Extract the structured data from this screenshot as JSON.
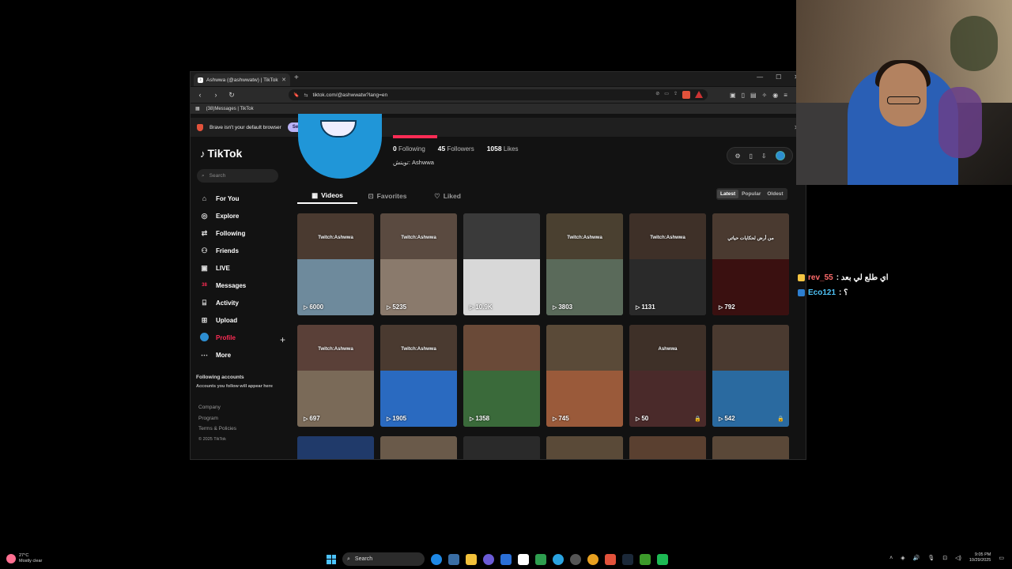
{
  "browser": {
    "tab_title": "Ashwwa (@ashwwatw) | TikTok",
    "url": "tiktok.com/@ashwwatw?lang=en",
    "bookmark": "(38)Messages | TikTok",
    "infobar_text": "Brave isn't your default browser",
    "set_default_label": "Set as default"
  },
  "sidebar": {
    "logo": "TikTok",
    "search_placeholder": "Search",
    "items": [
      {
        "label": "For You",
        "icon": "home-icon"
      },
      {
        "label": "Explore",
        "icon": "compass-icon"
      },
      {
        "label": "Following",
        "icon": "following-icon"
      },
      {
        "label": "Friends",
        "icon": "friends-icon"
      },
      {
        "label": "LIVE",
        "icon": "live-icon"
      },
      {
        "label": "Messages",
        "icon": "messages-icon"
      },
      {
        "label": "Activity",
        "icon": "activity-icon"
      },
      {
        "label": "Upload",
        "icon": "upload-icon"
      },
      {
        "label": "Profile",
        "icon": "avatar"
      },
      {
        "label": "More",
        "icon": "more-icon"
      }
    ],
    "messages_badge": "38",
    "following_accounts_title": "Following accounts",
    "following_accounts_sub": "Accounts you follow will appear here",
    "footer": [
      "Company",
      "Program",
      "Terms & Policies"
    ],
    "copyright": "© 2025 TikTok"
  },
  "profile": {
    "following_count": "0",
    "following_label": "Following",
    "followers_count": "45",
    "followers_label": "Followers",
    "likes_count": "1058",
    "likes_label": "Likes",
    "bio": "تويتش: Ashwwa",
    "tabs": [
      "Videos",
      "Favorites",
      "Liked"
    ],
    "sort": [
      "Latest",
      "Popular",
      "Oldest"
    ]
  },
  "videos": [
    {
      "views": "6000",
      "watermark": "Twitch:Ashwwa",
      "top": "#4a3a30",
      "bottom": "#6e8a9c",
      "lock": false
    },
    {
      "views": "5235",
      "watermark": "Twitch:Ashwwa",
      "top": "#5a4a40",
      "bottom": "#8a7a6c",
      "lock": false
    },
    {
      "views": "10.9K",
      "watermark": "",
      "top": "#3a3a3a",
      "bottom": "#d8d8d8",
      "lock": false
    },
    {
      "views": "3803",
      "watermark": "Twitch:Ashwwa",
      "top": "#4a4030",
      "bottom": "#5a6a5a",
      "lock": false
    },
    {
      "views": "1131",
      "watermark": "Twitch:Ashwwa",
      "top": "#3e3028",
      "bottom": "#2a2a2a",
      "lock": false
    },
    {
      "views": "792",
      "watermark": "من أرض لحكايات حياتي",
      "top": "#4a3a30",
      "bottom": "#3a1010",
      "lock": false
    },
    {
      "views": "697",
      "watermark": "Twitch:Ashwwa",
      "top": "#5a4038",
      "bottom": "#7a6a58",
      "lock": false
    },
    {
      "views": "1905",
      "watermark": "Twitch:Ashwwa",
      "top": "#4a3a30",
      "bottom": "#2a6ac0",
      "lock": false
    },
    {
      "views": "1358",
      "watermark": "",
      "top": "#6a4a38",
      "bottom": "#3a6a3a",
      "lock": false
    },
    {
      "views": "745",
      "watermark": "",
      "top": "#5a4a38",
      "bottom": "#9a5a3a",
      "lock": false
    },
    {
      "views": "50",
      "watermark": "Ashwwa",
      "top": "#3e3028",
      "bottom": "#4a2a2a",
      "lock": true
    },
    {
      "views": "542",
      "watermark": "",
      "top": "#4a3a30",
      "bottom": "#2a6aa0",
      "lock": true
    },
    {
      "views": "",
      "watermark": "",
      "top": "#203a6a",
      "bottom": "#203a6a",
      "lock": false
    },
    {
      "views": "",
      "watermark": "",
      "top": "#6a5a4a",
      "bottom": "#6a5a4a",
      "lock": false
    },
    {
      "views": "",
      "watermark": "",
      "top": "#2a2a2a",
      "bottom": "#2a2a2a",
      "lock": false
    },
    {
      "views": "",
      "watermark": "",
      "top": "#5a4a38",
      "bottom": "#5a4a38",
      "lock": false
    },
    {
      "views": "",
      "watermark": "",
      "top": "#5a4030",
      "bottom": "#5a4030",
      "lock": false
    },
    {
      "views": "",
      "watermark": "",
      "top": "#5a4838",
      "bottom": "#5a4838",
      "lock": false
    }
  ],
  "chat": [
    {
      "user": "rev_55",
      "message": ": اي طلع لي بعد",
      "color": "#ff6b6b"
    },
    {
      "user": "Eco121",
      "message": ": ؟",
      "color": "#4fc3f7"
    }
  ],
  "taskbar": {
    "temp": "27°C",
    "weather": "Mostly clear",
    "search": "Search",
    "time": "9:05 PM",
    "date": "10/29/2025"
  }
}
